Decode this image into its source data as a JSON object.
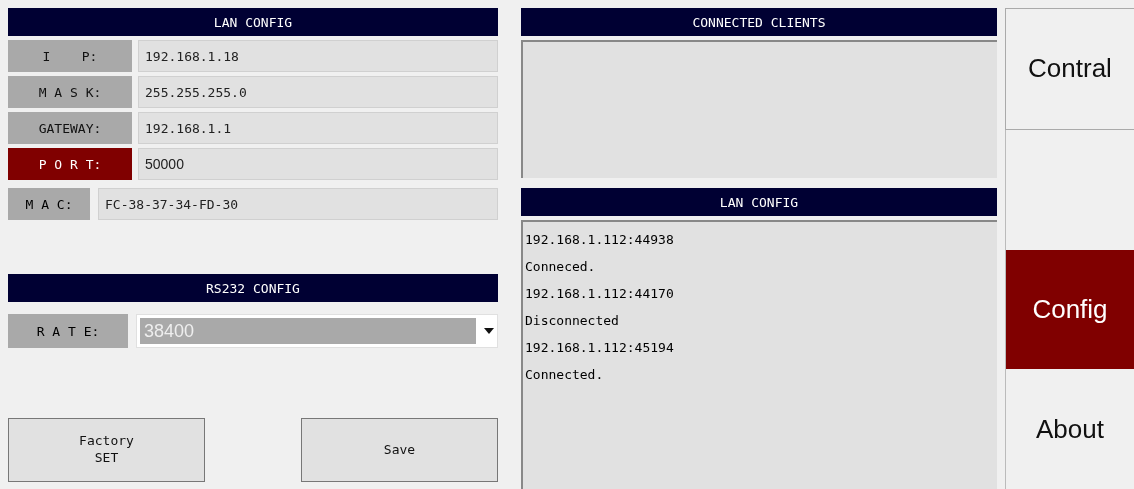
{
  "lan_config": {
    "title": "LAN CONFIG",
    "fields": [
      {
        "label": "I    P:",
        "value": "192.168.1.18",
        "selected": false,
        "kind": "mono"
      },
      {
        "label": "M A S K:",
        "value": "255.255.255.0",
        "selected": false,
        "kind": "mono"
      },
      {
        "label": "GATEWAY:",
        "value": "192.168.1.1",
        "selected": false,
        "kind": "mono"
      },
      {
        "label": "P O R T:",
        "value": "50000",
        "selected": true,
        "kind": "plain"
      }
    ],
    "mac": {
      "label": "M A C:",
      "value": "FC-38-37-34-FD-30"
    }
  },
  "rs232_config": {
    "title": "RS232 CONFIG",
    "rate": {
      "label": "R A T E:",
      "value": "38400",
      "disabled": true
    }
  },
  "buttons": [
    "Factory\nSET",
    "Save"
  ],
  "connected_clients": {
    "title": "CONNECTED CLIENTS"
  },
  "log": {
    "title": "LAN CONFIG",
    "lines": [
      "192.168.1.112:44938",
      "Conneced.",
      "192.168.1.112:44170",
      "Disconnected",
      "192.168.1.112:45194",
      "Connected."
    ]
  },
  "nav": [
    {
      "label": "Contral",
      "selected": false
    },
    {
      "label": "Config",
      "selected": true
    },
    {
      "label": "About",
      "selected": false
    }
  ]
}
